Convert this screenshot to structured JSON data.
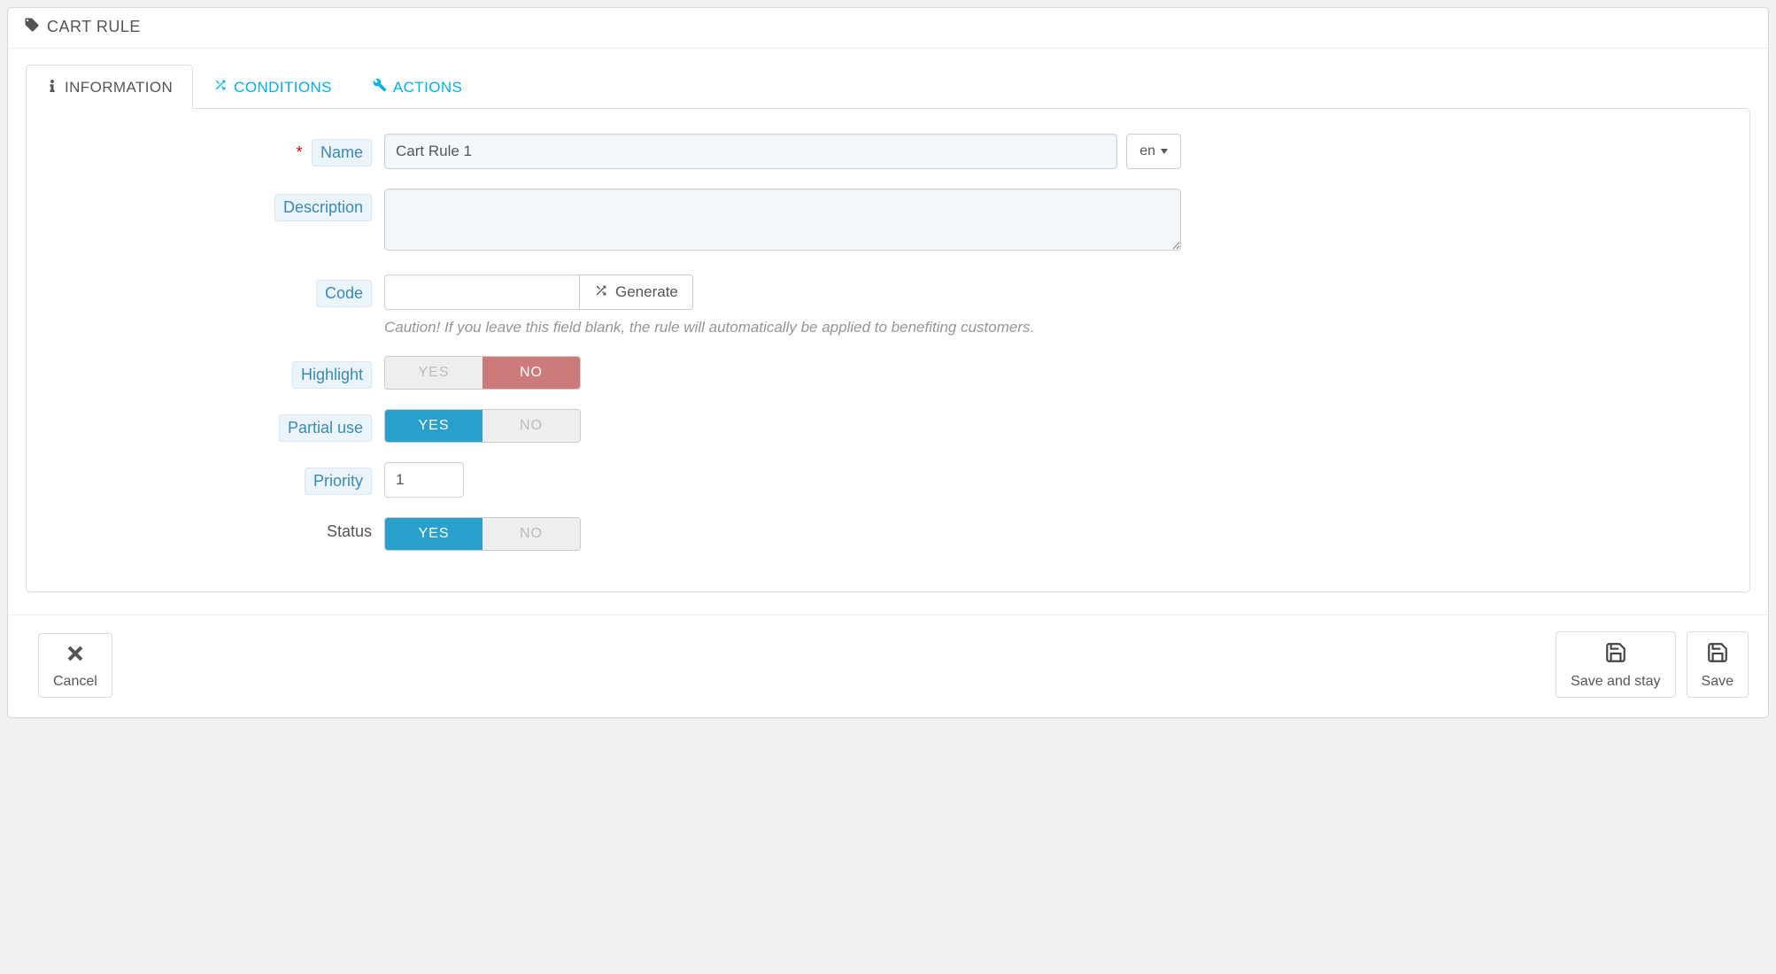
{
  "panel": {
    "title": "CART RULE"
  },
  "tabs": {
    "information": "INFORMATION",
    "conditions": "CONDITIONS",
    "actions": "ACTIONS"
  },
  "labels": {
    "name": "Name",
    "description": "Description",
    "code": "Code",
    "highlight": "Highlight",
    "partial_use": "Partial use",
    "priority": "Priority",
    "status": "Status"
  },
  "fields": {
    "name_value": "Cart Rule 1",
    "description_value": "",
    "code_value": "",
    "priority_value": "1"
  },
  "lang": {
    "label": "en"
  },
  "buttons": {
    "generate": "Generate",
    "cancel": "Cancel",
    "save_stay": "Save and stay",
    "save": "Save"
  },
  "help": {
    "code": "Caution! If you leave this field blank, the rule will automatically be applied to benefiting customers."
  },
  "toggle": {
    "yes": "YES",
    "no": "NO",
    "highlight_selected": "no",
    "partial_use_selected": "yes",
    "status_selected": "yes"
  }
}
